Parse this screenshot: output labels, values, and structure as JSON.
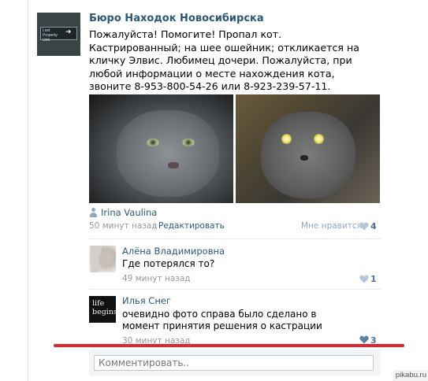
{
  "post": {
    "group_name": "Бюро Находок Новосибирска",
    "group_avatar_text": "Lost Property Unit",
    "text": "Пожалуйста! Помогите! Пропал кот. Кастрированный; на шее ошейник; откликается на кличку Элвис. Любимец дочери. Пожалуйста, при любой информации о месте нахождения кота, звоните 8-953-800-54-26 или 8-923-239-57-11.",
    "author": "Irina Vaulina",
    "time": "50 минут назад",
    "edit_label": "Редактировать",
    "like_label": "Мне нравится",
    "like_count": "4"
  },
  "comments": [
    {
      "name": "Алёна Владимировна",
      "text": "Где потерялся то?",
      "time": "49 минут назад",
      "likes": "1"
    },
    {
      "name": "Илья Снег",
      "avatar_text": "life begins",
      "text": "очевидно фото справа было сделано в момент принятия решения о кастрации",
      "time": "30 минут назад",
      "likes": "3"
    }
  ],
  "comment_box": {
    "placeholder": "Комментировать.."
  },
  "watermark": "pikabu.ru",
  "icons": {
    "author": "user-icon",
    "like": "heart-icon"
  },
  "colors": {
    "link": "#2b587a",
    "meta": "#999999",
    "like": "#8fa6bd",
    "highlight_line": "#e32330"
  }
}
